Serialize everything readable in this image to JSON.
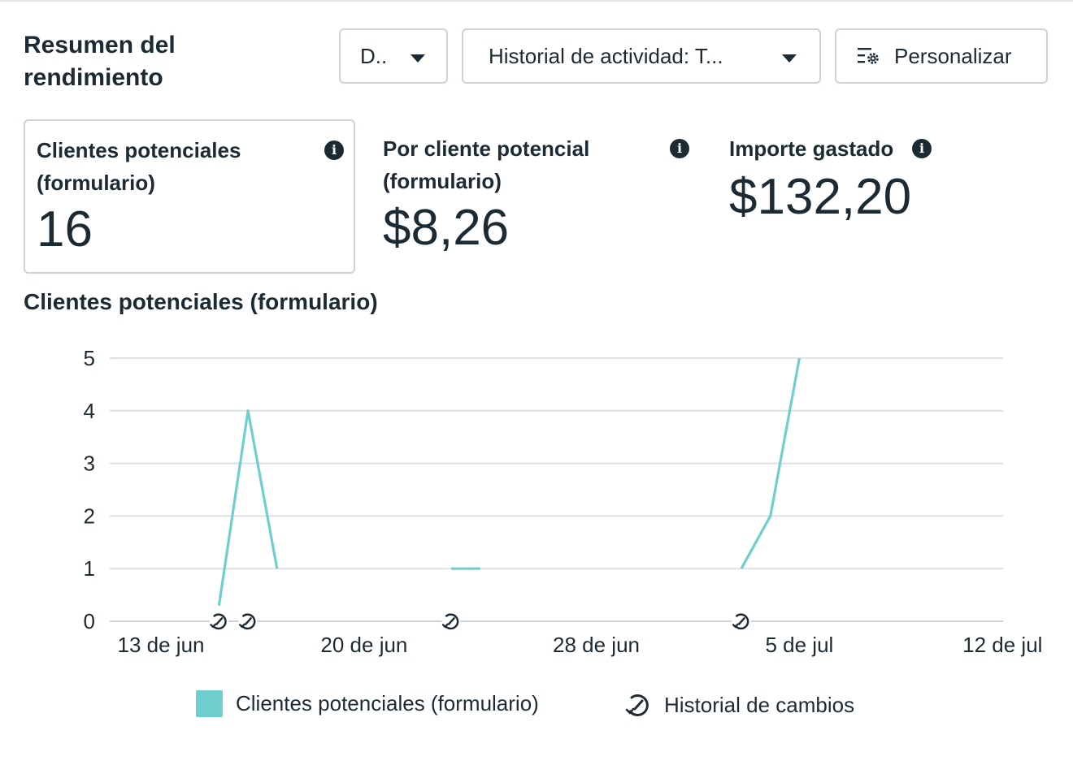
{
  "header": {
    "title": "Resumen del rendimiento",
    "date_button_label": "D..",
    "history_button_label": "Historial de actividad: T...",
    "customize_button_label": "Personalizar"
  },
  "metrics": [
    {
      "label": "Clientes potenciales (formulario)",
      "value": "16",
      "selected": true
    },
    {
      "label": "Por cliente potencial (formulario)",
      "value": "$8,26",
      "selected": false
    },
    {
      "label": "Importe gastado",
      "value": "$132,20",
      "selected": false
    }
  ],
  "chart_section": {
    "title": "Clientes potenciales (formulario)"
  },
  "chart_data": {
    "type": "line",
    "title": "Clientes potenciales (formulario)",
    "ylim": [
      0,
      5
    ],
    "y_ticks": [
      0,
      1,
      2,
      3,
      4,
      5
    ],
    "x_tick_labels": [
      "13 de jun",
      "20 de jun",
      "28 de jun",
      "5 de jul",
      "12 de jul"
    ],
    "x_tick_days": [
      0,
      7,
      15,
      22,
      29
    ],
    "series": [
      {
        "name": "Clientes potenciales (formulario)",
        "color": "#6fcfcf",
        "segments": [
          [
            {
              "x": 2,
              "y": 0.3
            },
            {
              "x": 3,
              "y": 4
            },
            {
              "x": 4,
              "y": 1
            }
          ],
          [
            {
              "x": 10,
              "y": 1
            },
            {
              "x": 11,
              "y": 1
            }
          ],
          [
            {
              "x": 20,
              "y": 1
            },
            {
              "x": 21,
              "y": 2
            },
            {
              "x": 22,
              "y": 5
            }
          ]
        ]
      }
    ],
    "change_history_days": [
      2,
      3,
      10,
      20
    ],
    "grid": true,
    "legend_position": "bottom-center"
  },
  "legend": {
    "series_label": "Clientes potenciales (formulario)",
    "history_label": "Historial de cambios",
    "series_color": "#6fcfcf"
  },
  "icons": {
    "caret": "caret-down-icon",
    "customize": "list-gear-icon",
    "info": "info-icon",
    "history": "change-history-icon"
  }
}
